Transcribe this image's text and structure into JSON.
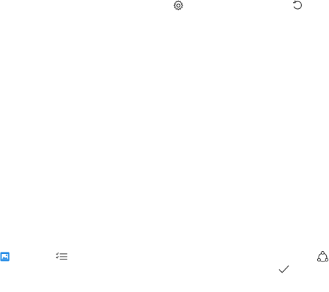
{
  "toolbar": {
    "icons": {
      "settings": "gear-icon",
      "rotate": "rotate-left-icon"
    }
  },
  "bottom_bar": {
    "icons": {
      "image": "image-icon",
      "checklist": "checklist-icon",
      "share": "share-icon",
      "confirm": "checkmark-icon"
    },
    "accent_color": "#1e88e5"
  }
}
